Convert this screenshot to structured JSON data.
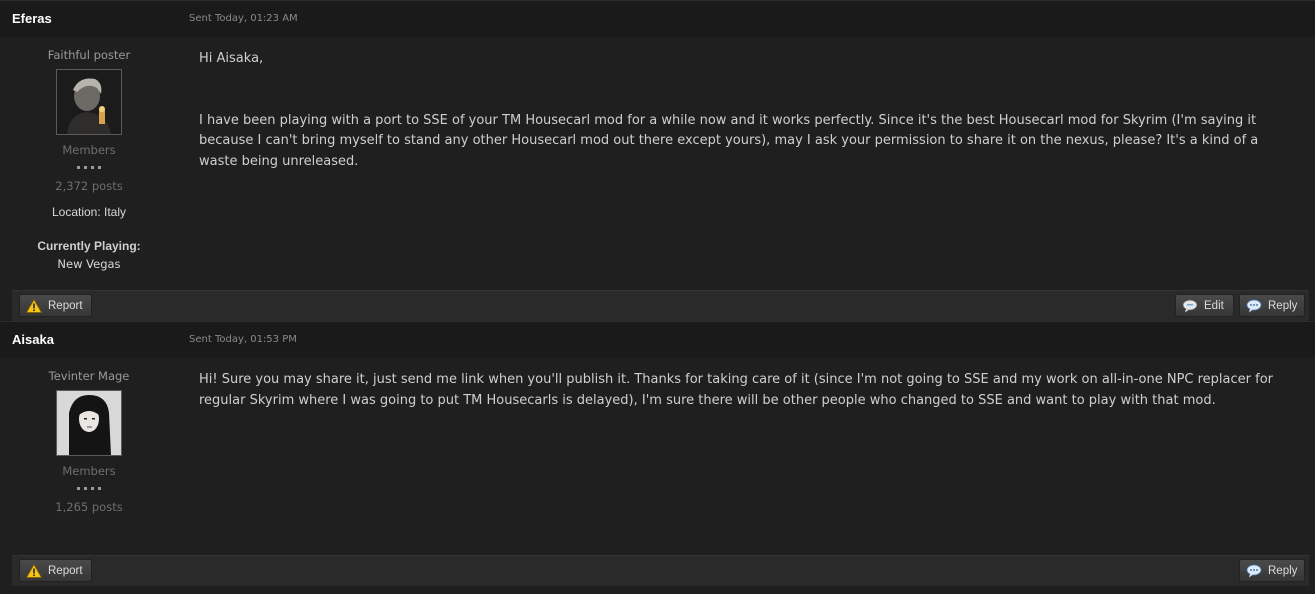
{
  "posts": [
    {
      "author": "Eferas",
      "date": "Sent Today, 01:23 AM",
      "title": "Faithful poster",
      "group": "Members",
      "post_count": "2,372 posts",
      "location": "Location: Italy",
      "playing_label": "Currently Playing:",
      "playing_value": "New Vegas",
      "body": {
        "greeting": "Hi Aisaka,",
        "text": "I have been playing with a port to SSE of your TM Housecarl mod for a while now and it works perfectly. Since it's the best Housecarl mod for Skyrim (I'm saying it because I can't bring myself to stand any other Housecarl mod out there except yours), may I ask your permission to share it on the nexus, please? It's a kind of a waste being unreleased."
      },
      "buttons": {
        "report": "Report",
        "edit": "Edit",
        "reply": "Reply"
      }
    },
    {
      "author": "Aisaka",
      "date": "Sent Today, 01:53 PM",
      "title": "Tevinter Mage",
      "group": "Members",
      "post_count": "1,265 posts",
      "body": {
        "text": "Hi! Sure you may share it, just send me link when you'll publish it. Thanks for taking care of it (since I'm not going to SSE and my work on all-in-one NPC replacer for regular Skyrim where I was going to put TM Housecarls is delayed), I'm sure there will be other people who changed to SSE and want to play with that mod."
      },
      "buttons": {
        "report": "Report",
        "reply": "Reply"
      }
    }
  ],
  "icons": {
    "report": "warning-icon",
    "edit": "speech-bubble-edit-icon",
    "reply": "speech-bubble-icon"
  },
  "colors": {
    "background": "#1c1c1c",
    "header": "#1a1a1a",
    "controls": "#2a2a2a",
    "warning": "#f5c518",
    "bubble": "#6fa8e0"
  }
}
